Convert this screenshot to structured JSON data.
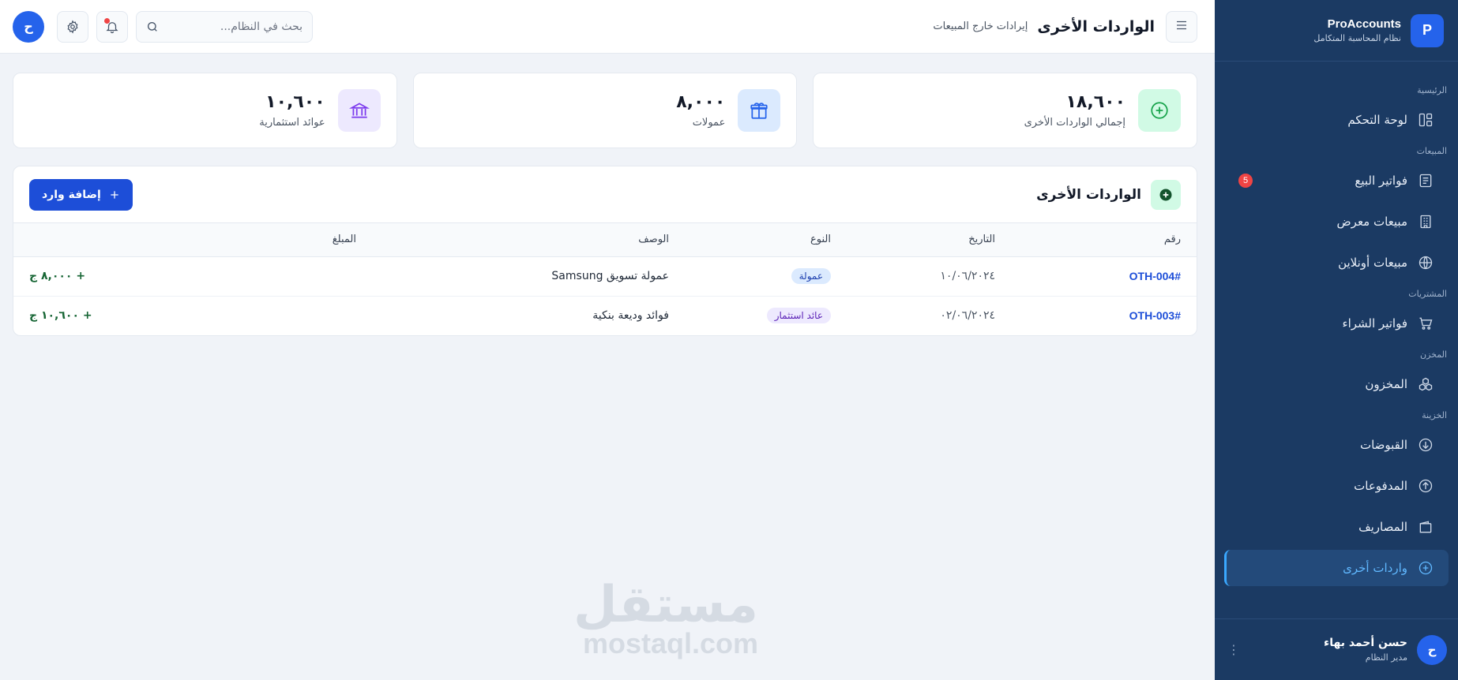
{
  "brand": {
    "logo_letter": "P",
    "name": "ProAccounts",
    "subtitle": "نظام المحاسبة المتكامل"
  },
  "sidebar": {
    "sections": [
      {
        "title": "الرئيسية",
        "items": [
          {
            "label": "لوحة التحكم",
            "icon": "dashboard-icon"
          }
        ]
      },
      {
        "title": "المبيعات",
        "items": [
          {
            "label": "فواتير البيع",
            "icon": "invoice-icon",
            "badge": "5"
          },
          {
            "label": "مبيعات معرض",
            "icon": "building-icon"
          },
          {
            "label": "مبيعات أونلاين",
            "icon": "globe-icon"
          }
        ]
      },
      {
        "title": "المشتريات",
        "items": [
          {
            "label": "فواتير الشراء",
            "icon": "cart-icon"
          }
        ]
      },
      {
        "title": "المخزن",
        "items": [
          {
            "label": "المخزون",
            "icon": "boxes-icon"
          }
        ]
      },
      {
        "title": "الخزينة",
        "items": [
          {
            "label": "القبوضات",
            "icon": "arrow-down-circle-icon"
          },
          {
            "label": "المدفوعات",
            "icon": "arrow-up-circle-icon"
          },
          {
            "label": "المصاريف",
            "icon": "wallet-icon"
          },
          {
            "label": "واردات أخرى",
            "icon": "plus-circle-icon",
            "active": true
          }
        ]
      }
    ]
  },
  "user": {
    "avatar_letter": "ح",
    "name": "حسن أحمد بهاء",
    "role": "مدير النظام",
    "more": "⋮"
  },
  "header": {
    "title": "الواردات الأخرى",
    "subtitle": "إيرادات خارج المبيعات",
    "search_placeholder": "بحث في النظام...",
    "avatar_letter": "ح"
  },
  "stats": [
    {
      "value": "١٨,٦٠٠",
      "label": "إجمالي الواردات الأخرى",
      "icon": "plus-circle-icon",
      "color": "#16a34a",
      "bg": "#d1fae5"
    },
    {
      "value": "٨,٠٠٠",
      "label": "عمولات",
      "icon": "gift-icon",
      "color": "#2563eb",
      "bg": "#dbeafe"
    },
    {
      "value": "١٠,٦٠٠",
      "label": "عوائد استثمارية",
      "icon": "bank-icon",
      "color": "#7c3aed",
      "bg": "#ede9fe"
    }
  ],
  "table_card": {
    "title": "الواردات الأخرى",
    "add_button": "إضافة وارد",
    "columns": [
      "رقم",
      "التاريخ",
      "النوع",
      "الوصف",
      "المبلغ"
    ],
    "rows": [
      {
        "ref": "OTH-004#",
        "date": "١٠/٠٦/٢٠٢٤",
        "type": "عمولة",
        "type_style": "blue",
        "description": "عمولة تسويق Samsung",
        "amount": "+ ٨,٠٠٠ ج"
      },
      {
        "ref": "OTH-003#",
        "date": "٠٢/٠٦/٢٠٢٤",
        "type": "عائد استثمار",
        "type_style": "purple",
        "description": "فوائد وديعة بنكية",
        "amount": "+ ١٠,٦٠٠ ج"
      }
    ]
  },
  "watermark": {
    "arabic": "مستقل",
    "latin": "mostaql.com"
  }
}
